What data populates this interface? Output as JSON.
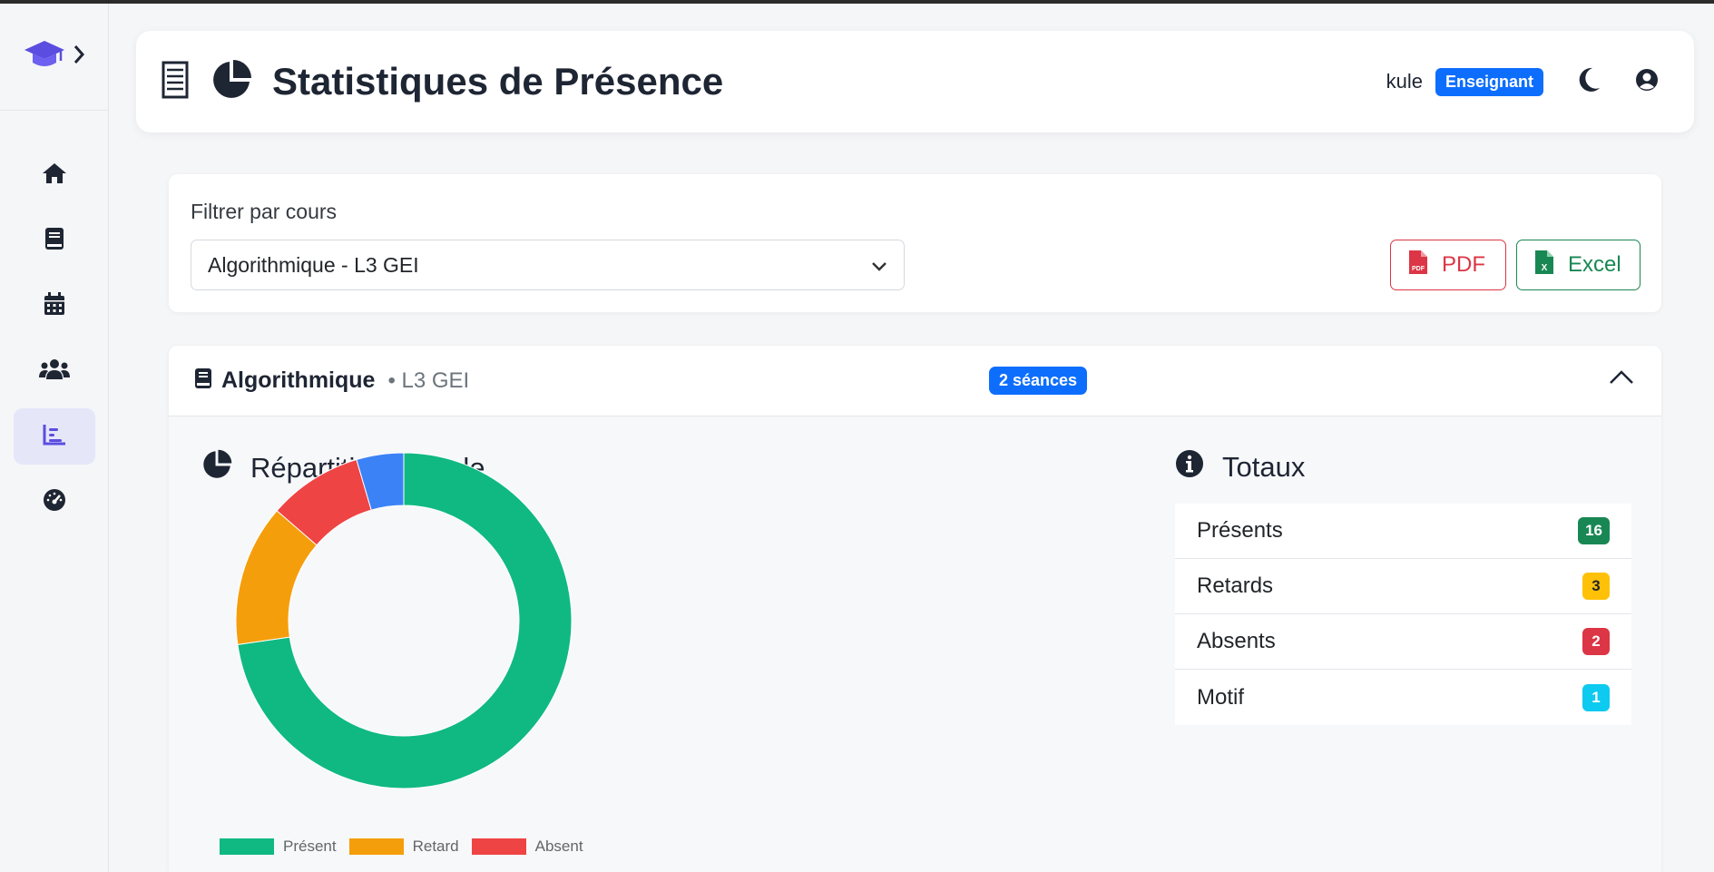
{
  "header": {
    "title": "Statistiques de Présence",
    "user": "kule",
    "role": "Enseignant"
  },
  "sidebar": {
    "items": [
      {
        "icon": "home-icon"
      },
      {
        "icon": "book-icon"
      },
      {
        "icon": "calendar-icon"
      },
      {
        "icon": "users-icon"
      },
      {
        "icon": "chart-bar-icon",
        "active": true
      },
      {
        "icon": "gauge-icon"
      }
    ]
  },
  "filter": {
    "label": "Filtrer par cours",
    "selected": "Algorithmique - L3 GEI",
    "pdf_label": "PDF",
    "excel_label": "Excel"
  },
  "course": {
    "name": "Algorithmique",
    "class": "• L3 GEI",
    "sessions": "2 séances",
    "chart_title": "Répartition globale",
    "totals_title": "Totaux",
    "totals": [
      {
        "label": "Présents",
        "value": "16",
        "color": "#198754",
        "text": "#ffffff"
      },
      {
        "label": "Retards",
        "value": "3",
        "color": "#ffc107",
        "text": "#212529"
      },
      {
        "label": "Absents",
        "value": "2",
        "color": "#dc3545",
        "text": "#ffffff"
      },
      {
        "label": "Motif",
        "value": "1",
        "color": "#0dcaf0",
        "text": "#ffffff"
      }
    ]
  },
  "chart_data": {
    "type": "pie",
    "title": "",
    "categories": [
      "Présent",
      "Retard",
      "Absent",
      "Motif"
    ],
    "values": [
      16,
      3,
      2,
      1
    ],
    "colors": [
      "#10b981",
      "#f59e0b",
      "#ef4444",
      "#3b82f6"
    ],
    "legend_labels": [
      "Présent",
      "Retard",
      "Absent"
    ],
    "legend_position": "bottom"
  }
}
